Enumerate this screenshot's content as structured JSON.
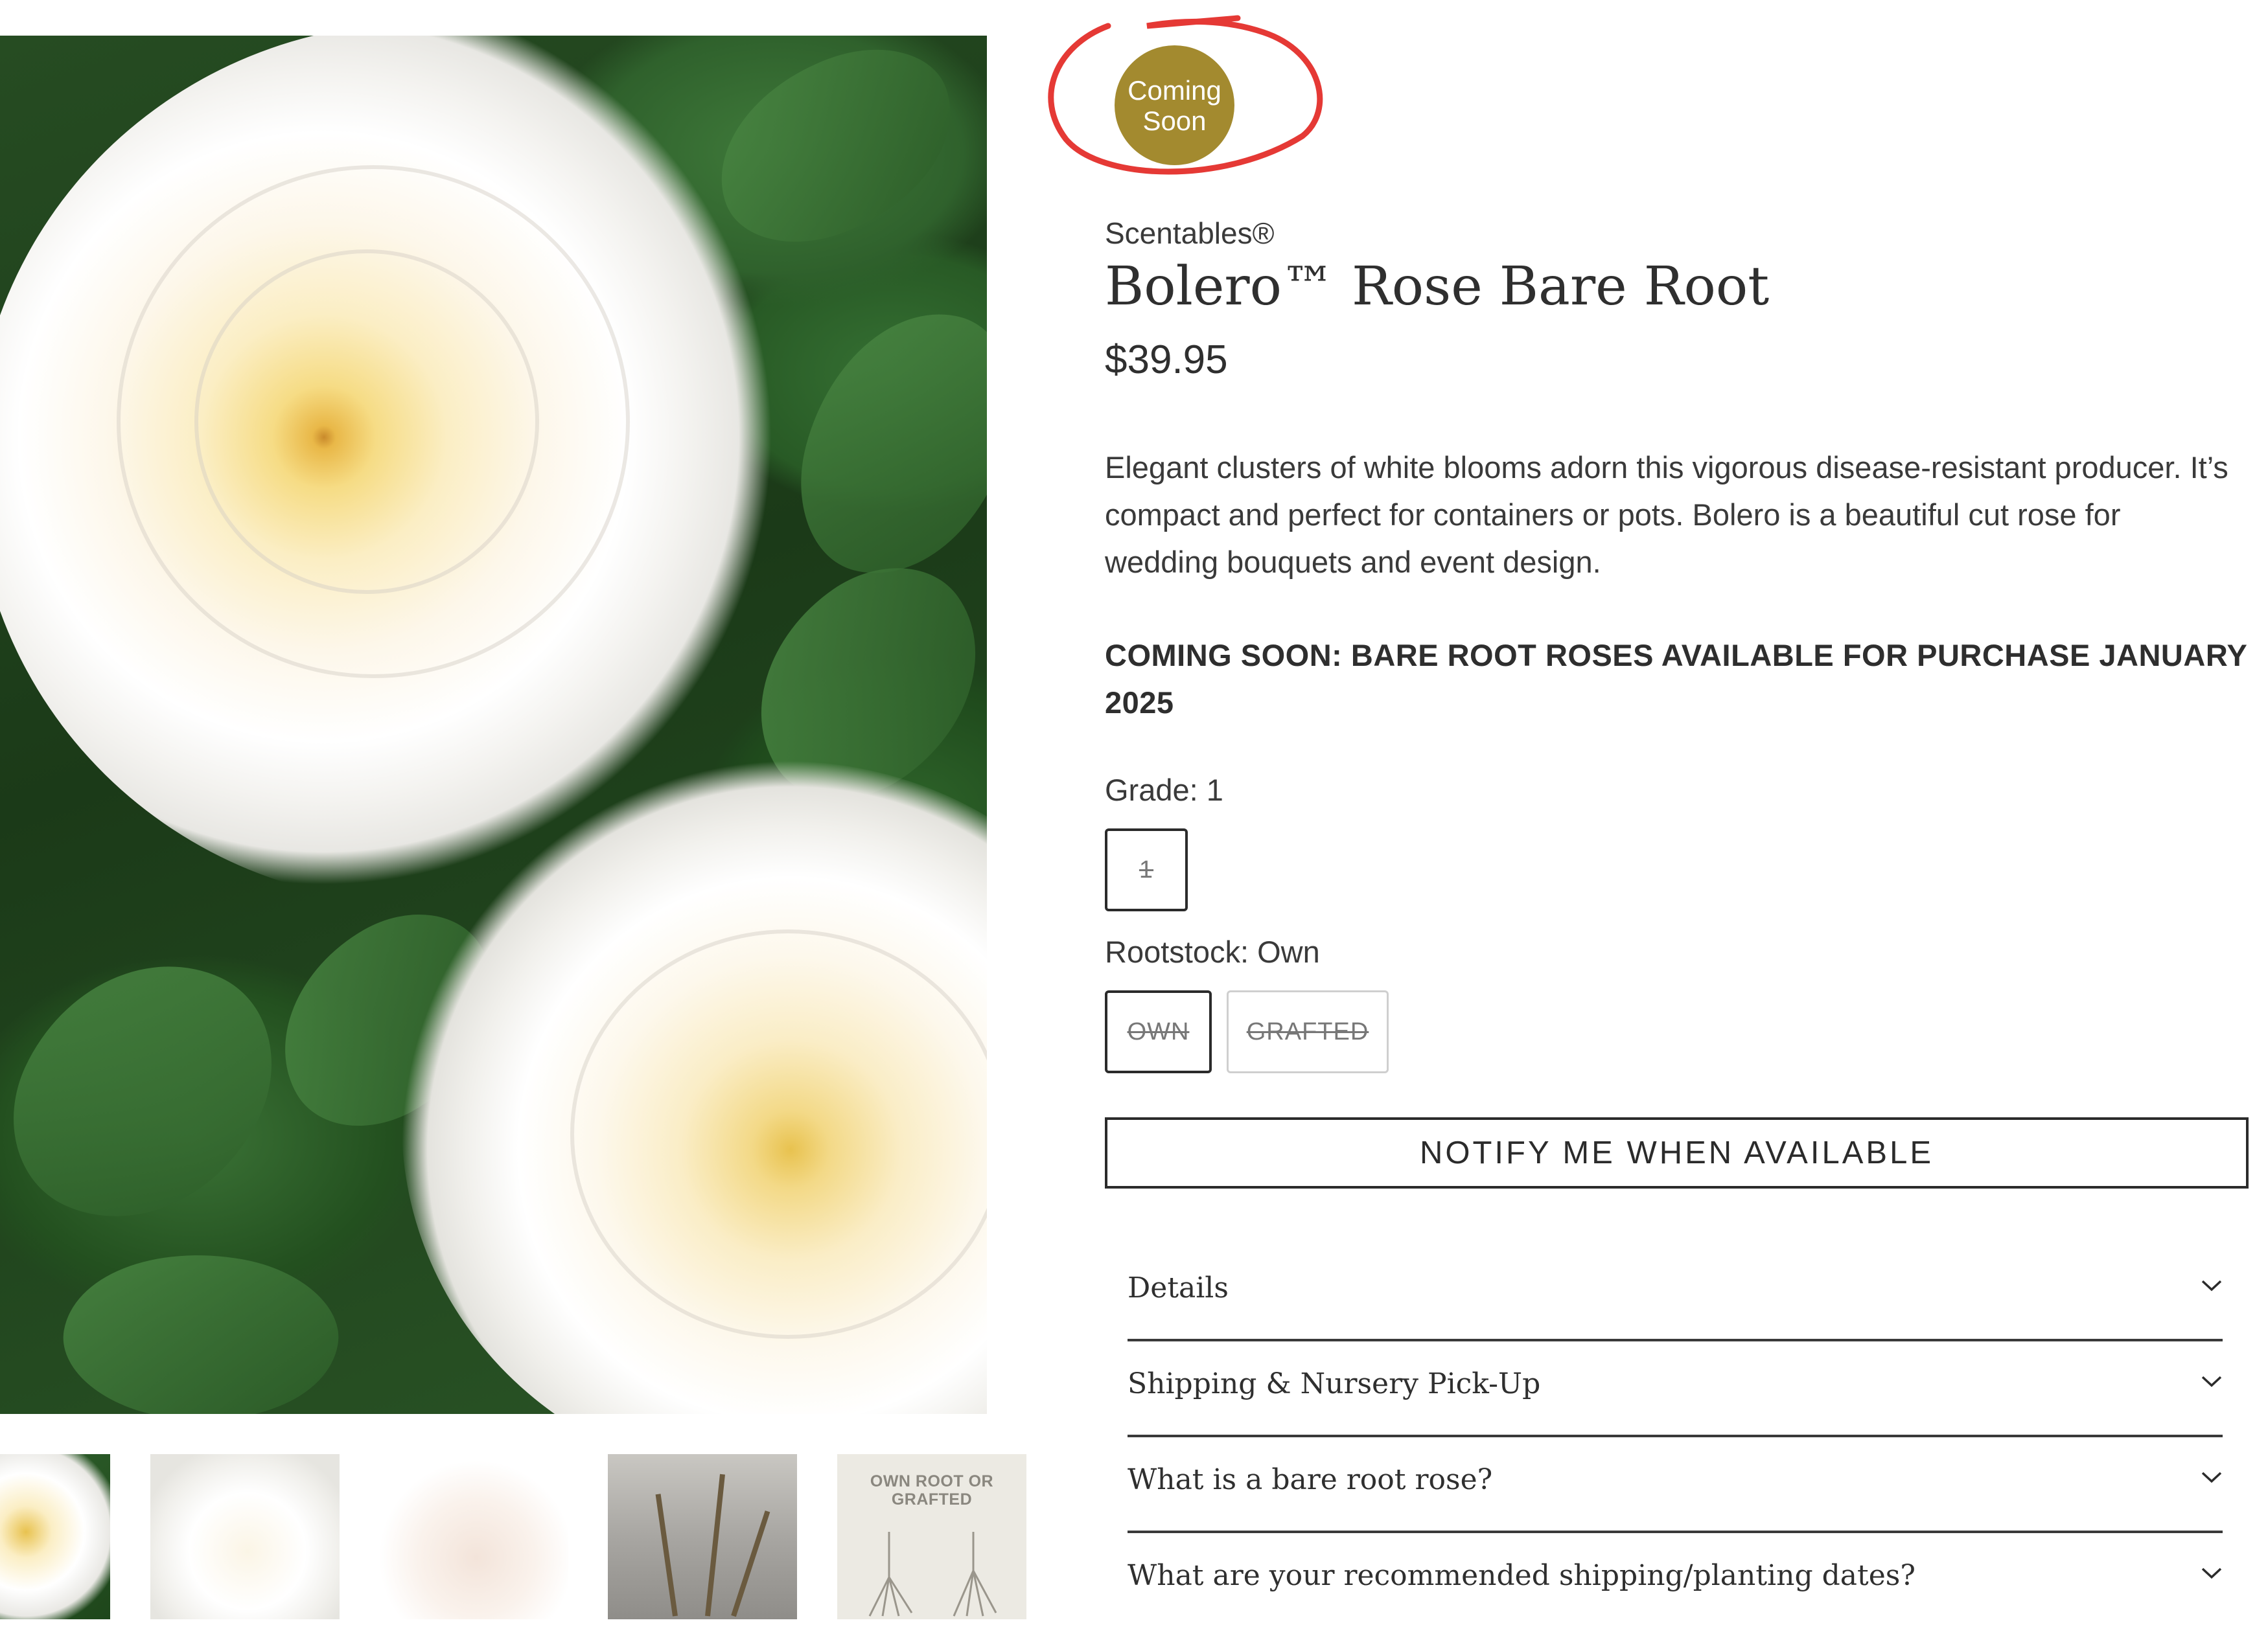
{
  "badge": {
    "line1": "Coming",
    "line2": "Soon",
    "color": "#a38a2f",
    "annotation_color": "#e53935"
  },
  "product": {
    "brand": "Scentables®",
    "title": "Bolero™  Rose Bare Root",
    "price": "$39.95",
    "description": "Elegant clusters of white blooms adorn this vigorous disease-resistant producer. It’s compact and perfect for containers or pots. Bolero is a beautiful cut rose for wedding bouquets and event design.",
    "notice": "COMING SOON: BARE ROOT ROSES AVAILABLE FOR PURCHASE JANUARY 2025"
  },
  "options": {
    "grade": {
      "label": "Grade: 1",
      "values": [
        "1"
      ]
    },
    "rootstock": {
      "label": "Rootstock: Own",
      "values": [
        "OWN",
        "GRAFTED"
      ]
    }
  },
  "cta": {
    "notify_label": "NOTIFY ME WHEN AVAILABLE"
  },
  "accordion": [
    {
      "label": "Details"
    },
    {
      "label": "Shipping & Nursery Pick-Up"
    },
    {
      "label": "What is a bare root rose?"
    },
    {
      "label": "What are your recommended shipping/planting dates?"
    }
  ],
  "gallery": {
    "thumb5_title": "OWN ROOT OR GRAFTED"
  }
}
